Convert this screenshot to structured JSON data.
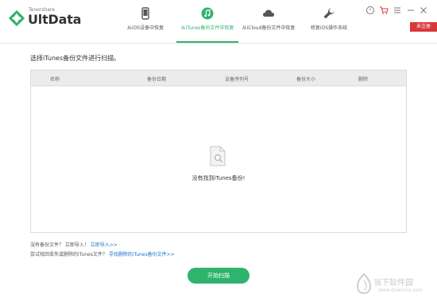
{
  "app": {
    "brand_small": "Tenorshare",
    "brand_name": "UltData",
    "register_badge": "未注册"
  },
  "tabs": [
    {
      "label": "从iOS设备中恢复",
      "icon": "phone-icon",
      "active": false
    },
    {
      "label": "从iTunes备份文件中恢复",
      "icon": "music-icon",
      "active": true
    },
    {
      "label": "从iCloud备份文件中恢复",
      "icon": "cloud-icon",
      "active": false
    },
    {
      "label": "修复iOS操作系统",
      "icon": "wrench-icon",
      "active": false
    }
  ],
  "top_icons": [
    "clock-icon",
    "cart-icon",
    "menu-icon",
    "minimize-icon",
    "close-icon"
  ],
  "main": {
    "prompt": "选择iTunes备份文件进行扫描。",
    "columns": [
      "名称",
      "备份日期",
      "设备序列号",
      "备份大小",
      "删除"
    ],
    "empty_text": "没有找到iTunes备份!"
  },
  "hints": {
    "line1_text": "没有备份文件？ 立即导入！",
    "line1_link": "立即导入>>",
    "line2_text": "尝试找回丢失或删除的iTunes文件？",
    "line2_link": "寻找删除的iTunes备份文件>>"
  },
  "start_button": "开始扫描",
  "watermark": {
    "text": "当下软件园",
    "url": "www.downxia.com"
  },
  "colors": {
    "accent": "#2fb36d",
    "link": "#1a73c9",
    "badge": "#d9383a"
  }
}
